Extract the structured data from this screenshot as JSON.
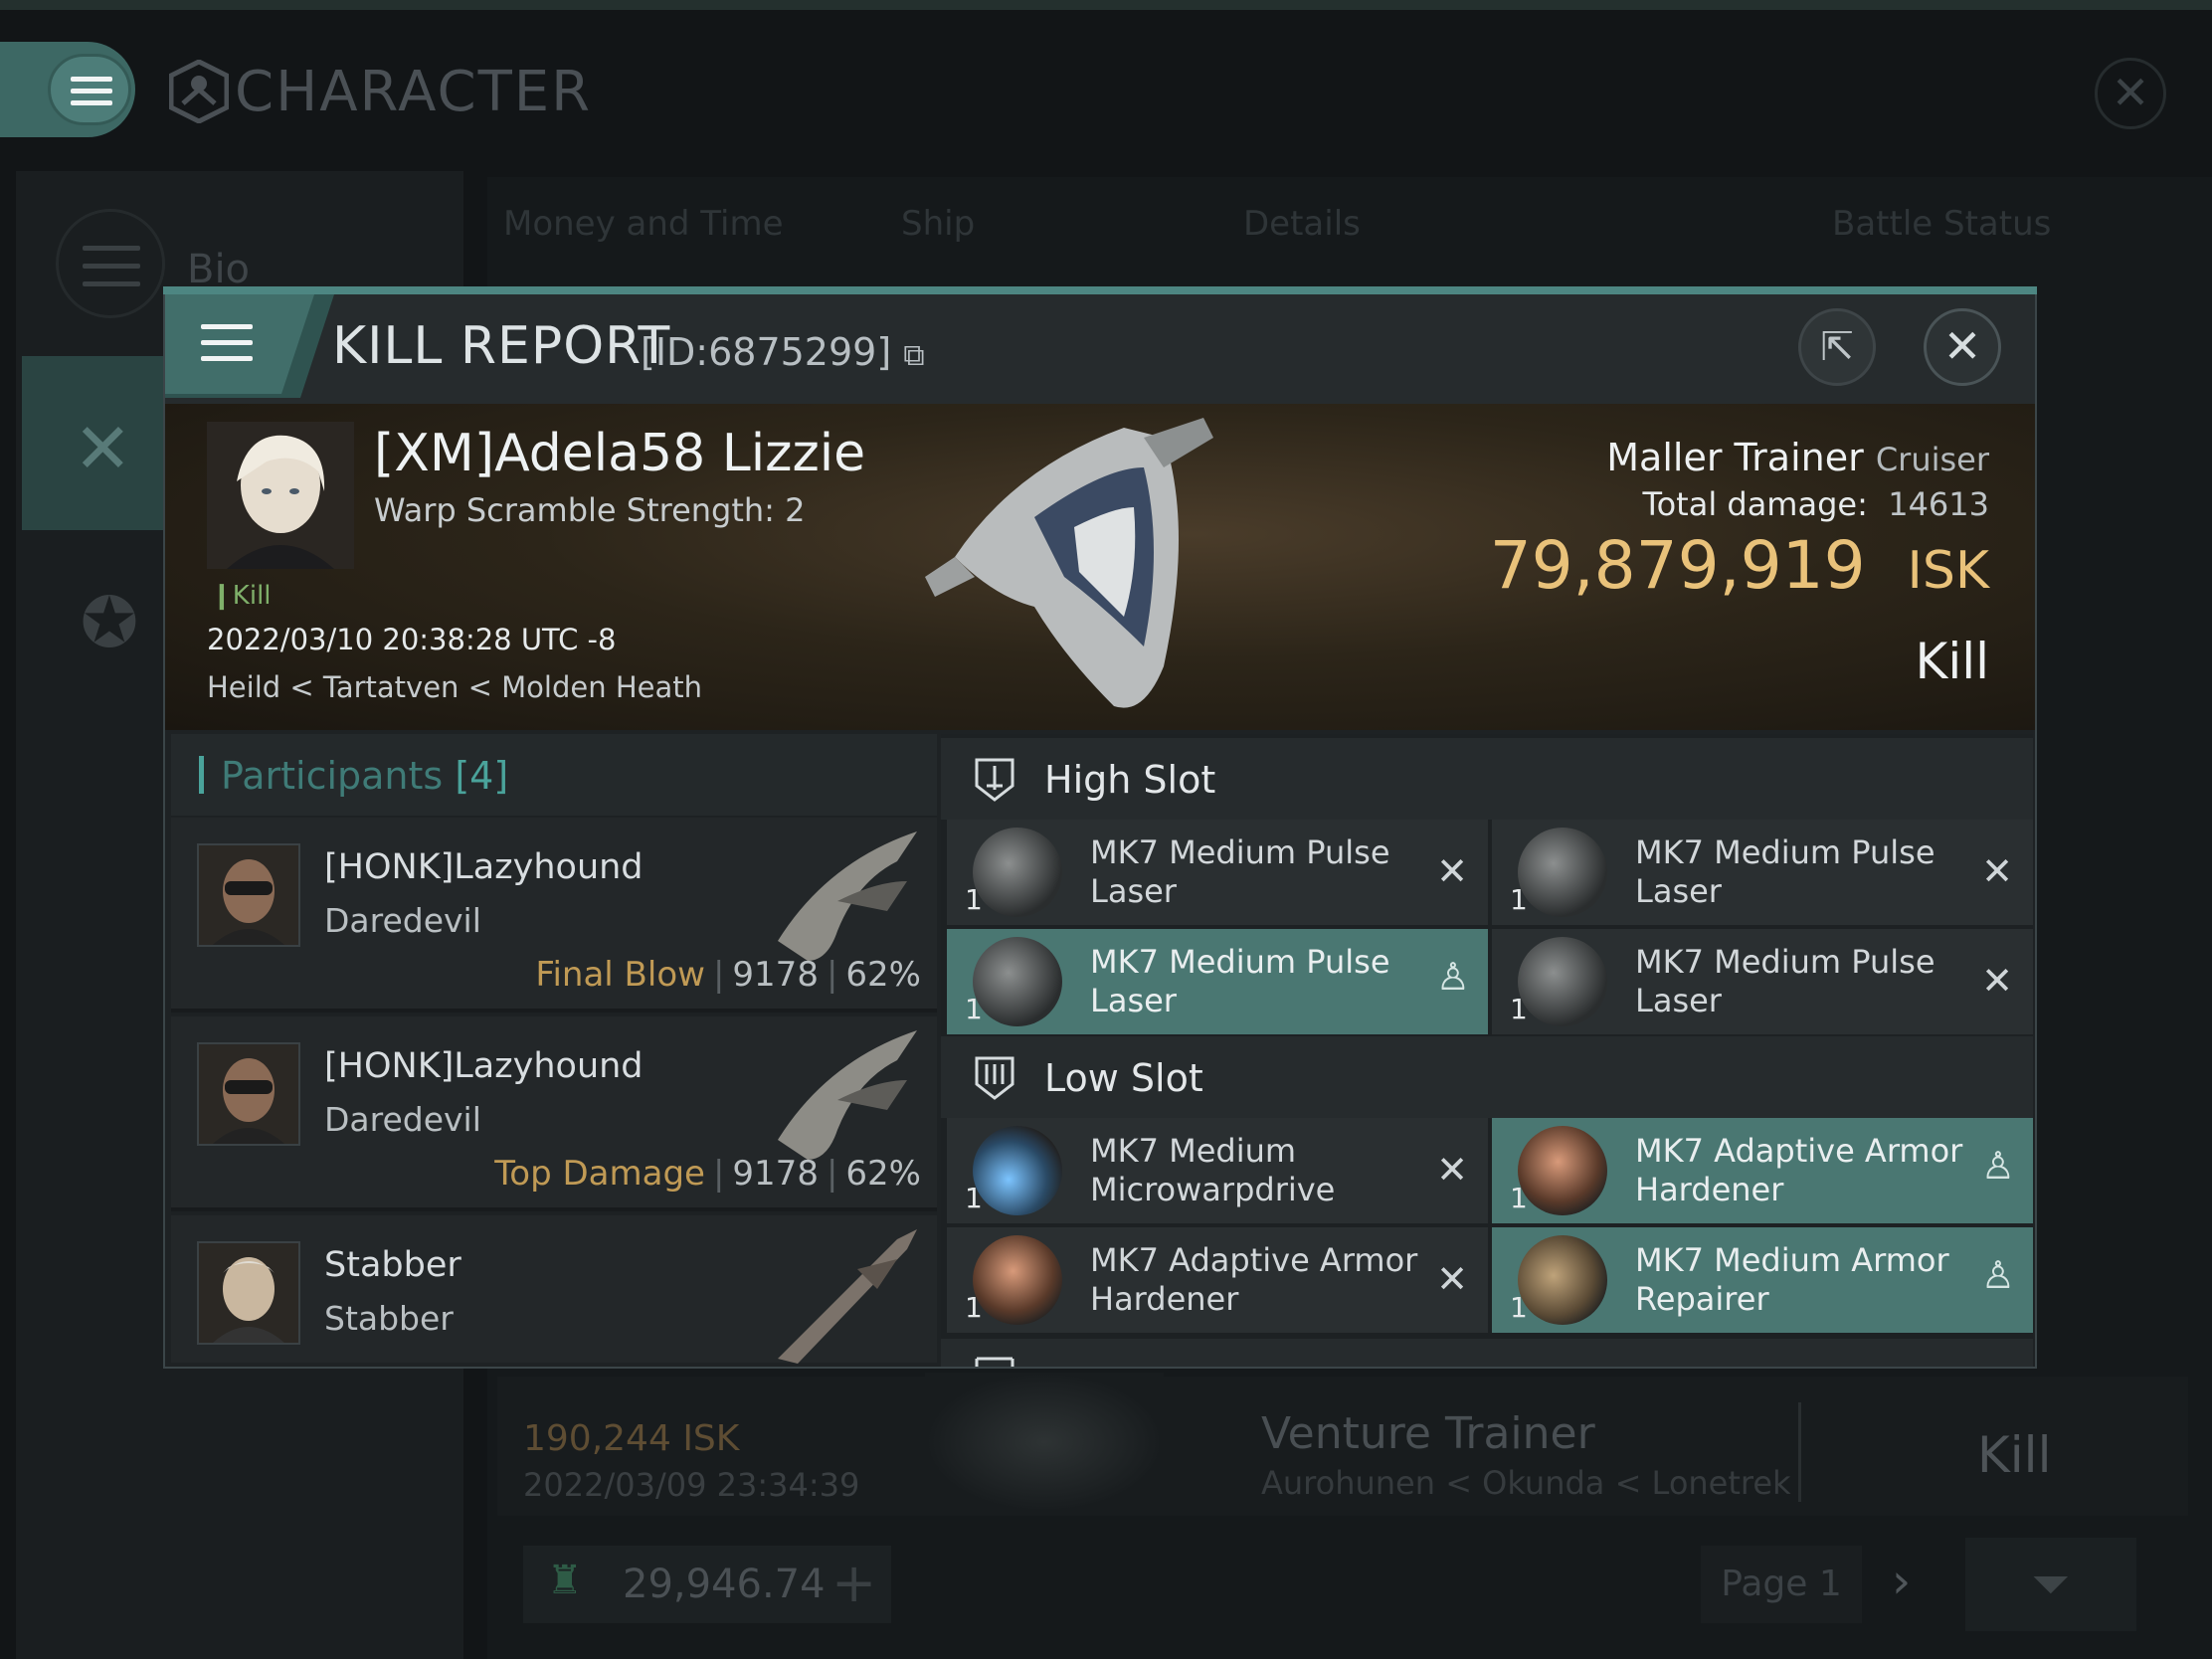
{
  "app": {
    "title": "CHARACTER",
    "sidebar": {
      "bio_label": "Bio"
    },
    "tabs": [
      "Money and Time",
      "Ship",
      "Details",
      "Battle Status"
    ],
    "background_row": {
      "isk": "190,244  ISK",
      "date": "2022/03/09  23:34:39",
      "ship": "Venture Trainer",
      "location": "Aurohunen < Okunda < Lonetrek",
      "result": "Kill"
    },
    "wallet": "29,946.74",
    "page": "Page 1"
  },
  "modal": {
    "title": "KILL REPORT",
    "id": "[ID:6875299]",
    "victim": {
      "name": "[XM]Adela58 Lizzie",
      "subtitle": "Warp Scramble Strength: 2",
      "tag": "Kill",
      "datetime": "2022/03/10 20:38:28 UTC -8",
      "location": "Heild < Tartatven < Molden Heath"
    },
    "ship": {
      "name": "Maller Trainer",
      "class": "Cruiser"
    },
    "total_damage_label": "Total damage:",
    "total_damage": "14613",
    "isk_value": "79,879,919",
    "isk_unit": "ISK",
    "result": "Kill",
    "participants_label": "Participants",
    "participants_count": "[4]",
    "participants": [
      {
        "name": "[HONK]Lazyhound",
        "ship": "Daredevil",
        "tag": "Final Blow",
        "damage": "9178",
        "percent": "62%"
      },
      {
        "name": "[HONK]Lazyhound",
        "ship": "Daredevil",
        "tag": "Top Damage",
        "damage": "9178",
        "percent": "62%"
      },
      {
        "name": "Stabber",
        "ship": "Stabber"
      }
    ],
    "high_slot_label": "High Slot",
    "high_slot": [
      {
        "name": "MK7 Medium Pulse Laser",
        "qty": "1",
        "state": "destroyed"
      },
      {
        "name": "MK7 Medium Pulse Laser",
        "qty": "1",
        "state": "destroyed"
      },
      {
        "name": "MK7 Medium Pulse Laser",
        "qty": "1",
        "state": "dropped"
      },
      {
        "name": "MK7 Medium Pulse Laser",
        "qty": "1",
        "state": "destroyed"
      }
    ],
    "low_slot_label": "Low Slot",
    "low_slot": [
      {
        "name": "MK7 Medium Microwarpdrive",
        "qty": "1",
        "state": "destroyed"
      },
      {
        "name": "MK7 Adaptive Armor Hardener",
        "qty": "1",
        "state": "dropped"
      },
      {
        "name": "MK7 Adaptive Armor Hardener",
        "qty": "1",
        "state": "destroyed"
      },
      {
        "name": "MK7 Medium Armor Repairer",
        "qty": "1",
        "state": "dropped"
      }
    ]
  },
  "colors": {
    "accent": "#4d8682",
    "isk": "#e9c27a",
    "tag": "#c09a55",
    "highlight": "#4a7772"
  }
}
